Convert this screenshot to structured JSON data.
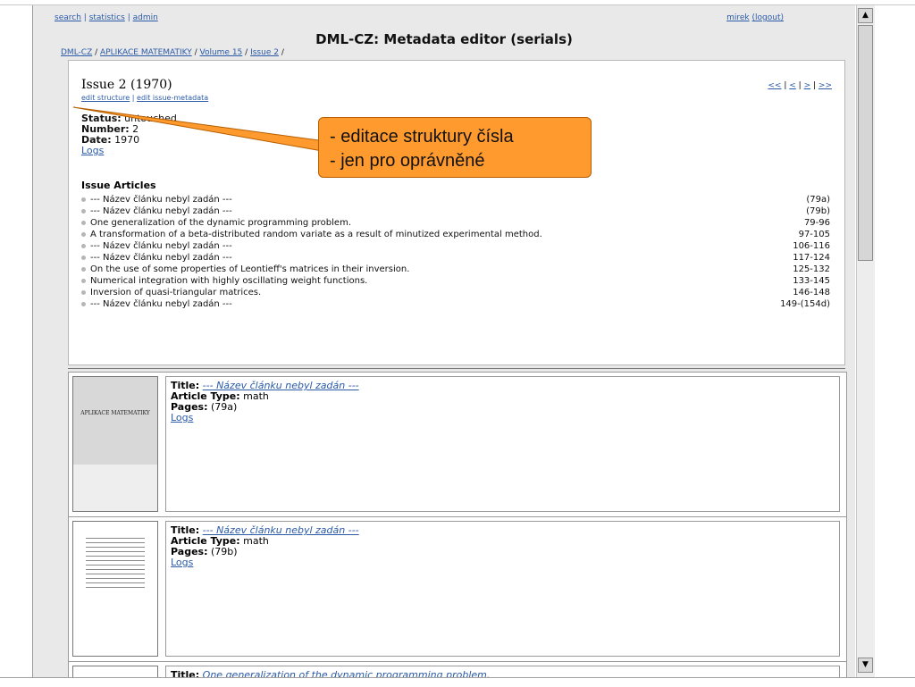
{
  "topnav": {
    "search": "search",
    "statistics": "statistics",
    "admin": "admin"
  },
  "user": {
    "name": "mirek",
    "logout": "(logout)"
  },
  "app_title": "DML-CZ: Metadata editor (serials)",
  "breadcrumb": [
    {
      "label": "DML-CZ",
      "link": true
    },
    {
      "label": "APLIKACE MATEMATIKY",
      "link": true
    },
    {
      "label": "Volume 15",
      "link": true
    },
    {
      "label": "Issue 2",
      "link": true
    }
  ],
  "issue": {
    "title": "Issue 2 (1970)",
    "edit_structure": "edit structure",
    "edit_metadata": "edit issue-metadata",
    "pager": {
      "first": "<<",
      "prev": "<",
      "next": ">",
      "last": ">>"
    },
    "status_label": "Status:",
    "status_value": "untouched",
    "number_label": "Number:",
    "number_value": "2",
    "date_label": "Date:",
    "date_value": "1970",
    "logs": "Logs",
    "articles_heading": "Issue Articles",
    "articles": [
      {
        "title": "--- Název článku nebyl zadán ---",
        "pages": "(79a)"
      },
      {
        "title": "--- Název článku nebyl zadán ---",
        "pages": "(79b)"
      },
      {
        "title": "One generalization of the dynamic programming problem.",
        "pages": "79-96"
      },
      {
        "title": "A transformation of a beta-distributed random variate as a result of minutized experimental method.",
        "pages": "97-105"
      },
      {
        "title": "--- Název článku nebyl zadán ---",
        "pages": "106-116"
      },
      {
        "title": "--- Název článku nebyl zadán ---",
        "pages": "117-124"
      },
      {
        "title": "On the use of some properties of Leontieff's matrices in their inversion.",
        "pages": "125-132"
      },
      {
        "title": "Numerical integration with highly oscillating weight functions.",
        "pages": "133-145"
      },
      {
        "title": "Inversion of quasi-triangular matrices.",
        "pages": "146-148"
      },
      {
        "title": "--- Název článku nebyl zadán ---",
        "pages": "149-(154d)"
      }
    ]
  },
  "callout": {
    "line1": "- editace struktury čísla",
    "line2": "- jen pro oprávněné"
  },
  "cards": [
    {
      "title_label": "Title:",
      "title": "--- Název článku nebyl zadán ---",
      "type_label": "Article Type:",
      "type": "math",
      "pages_label": "Pages:",
      "pages": "(79a)",
      "logs": "Logs",
      "thumb_text": "APLIKACE MATEMATIKY"
    },
    {
      "title_label": "Title:",
      "title": "--- Název článku nebyl zadán ---",
      "type_label": "Article Type:",
      "type": "math",
      "pages_label": "Pages:",
      "pages": "(79b)",
      "logs": "Logs",
      "thumb_text": ""
    },
    {
      "title_label": "Title:",
      "title": "One generalization of the dynamic programming problem."
    }
  ]
}
